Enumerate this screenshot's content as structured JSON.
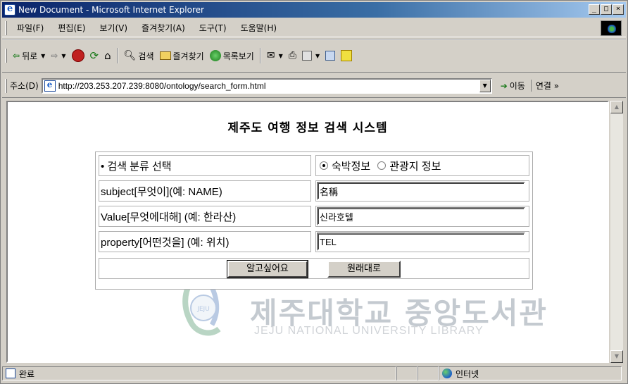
{
  "window": {
    "title": "New Document - Microsoft Internet Explorer",
    "controls": {
      "minimize": "_",
      "maximize": "□",
      "close": "×"
    }
  },
  "menubar": {
    "items": [
      "파일(F)",
      "편집(E)",
      "보기(V)",
      "즐겨찾기(A)",
      "도구(T)",
      "도움말(H)"
    ]
  },
  "toolbar": {
    "back": "뒤로",
    "search": "검색",
    "favorites": "즐겨찾기",
    "history": "목록보기"
  },
  "address": {
    "label": "주소(D)",
    "url": "http://203.253.207.239:8080/ontology/search_form.html",
    "go": "이동",
    "links": "연결 »"
  },
  "page": {
    "title": "제주도 여행 정보 검색 시스템",
    "form": {
      "category_label": "• 검색 분류 선택",
      "category_options": [
        "숙박정보",
        "관광지 정보"
      ],
      "category_selected": "숙박정보",
      "subject_label": "subject[무엇이](예: NAME)",
      "subject_value": "名稱",
      "value_label": "Value[무엇에대해] (예: 한라산)",
      "value_value": "신라호텔",
      "property_label": "property[어떤것을] (예: 위치)",
      "property_value": "TEL",
      "submit_label": "알고싶어요",
      "reset_label": "원래대로"
    },
    "watermark": {
      "name": "제주대학교 중앙도서관",
      "subtitle": "JEJU NATIONAL UNIVERSITY LIBRARY",
      "logo_text": "JEJU"
    }
  },
  "statusbar": {
    "status": "완료",
    "zone": "인터넷"
  }
}
